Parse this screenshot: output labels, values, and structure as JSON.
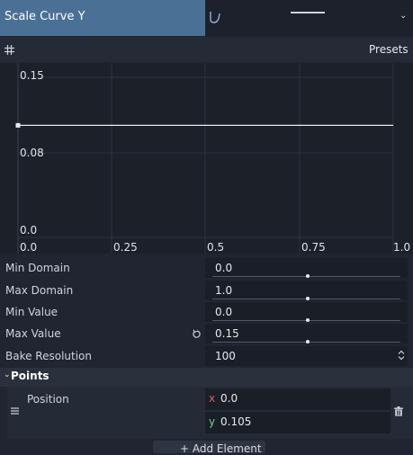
{
  "header": {
    "title": "Scale Curve Y"
  },
  "toolbar": {
    "presets_label": "Presets"
  },
  "curve": {
    "y_ticks": [
      "0.15",
      "0.08",
      "0.0"
    ],
    "x_ticks": [
      "0.0",
      "0.25",
      "0.5",
      "0.75",
      "1.0"
    ],
    "x_range": [
      0.0,
      1.0
    ],
    "y_range": [
      0.0,
      0.15
    ],
    "points": [
      [
        0.0,
        0.105
      ],
      [
        1.0,
        0.105
      ]
    ],
    "line_color": "#e6e9ee",
    "grid": true
  },
  "properties": [
    {
      "label": "Min Domain",
      "value": "0.0",
      "slider": 0.5
    },
    {
      "label": "Max Domain",
      "value": "1.0",
      "slider": 0.5
    },
    {
      "label": "Min Value",
      "value": "0.0",
      "slider": 0.5
    },
    {
      "label": "Max Value",
      "value": "0.15",
      "slider": 0.5,
      "revert": true
    },
    {
      "label": "Bake Resolution",
      "value": "100",
      "spinner": true
    }
  ],
  "points_section": {
    "title": "Points",
    "item_label": "Position",
    "x_label": "x",
    "x_value": "0.0",
    "y_label": "y",
    "y_value": "0.105"
  },
  "add_button": {
    "label": "+ Add Element"
  },
  "colors": {
    "header_bg": "#4a7096",
    "panel_bg": "#202531",
    "x_axis": "#e05c6c",
    "y_axis": "#6ccf8c"
  }
}
